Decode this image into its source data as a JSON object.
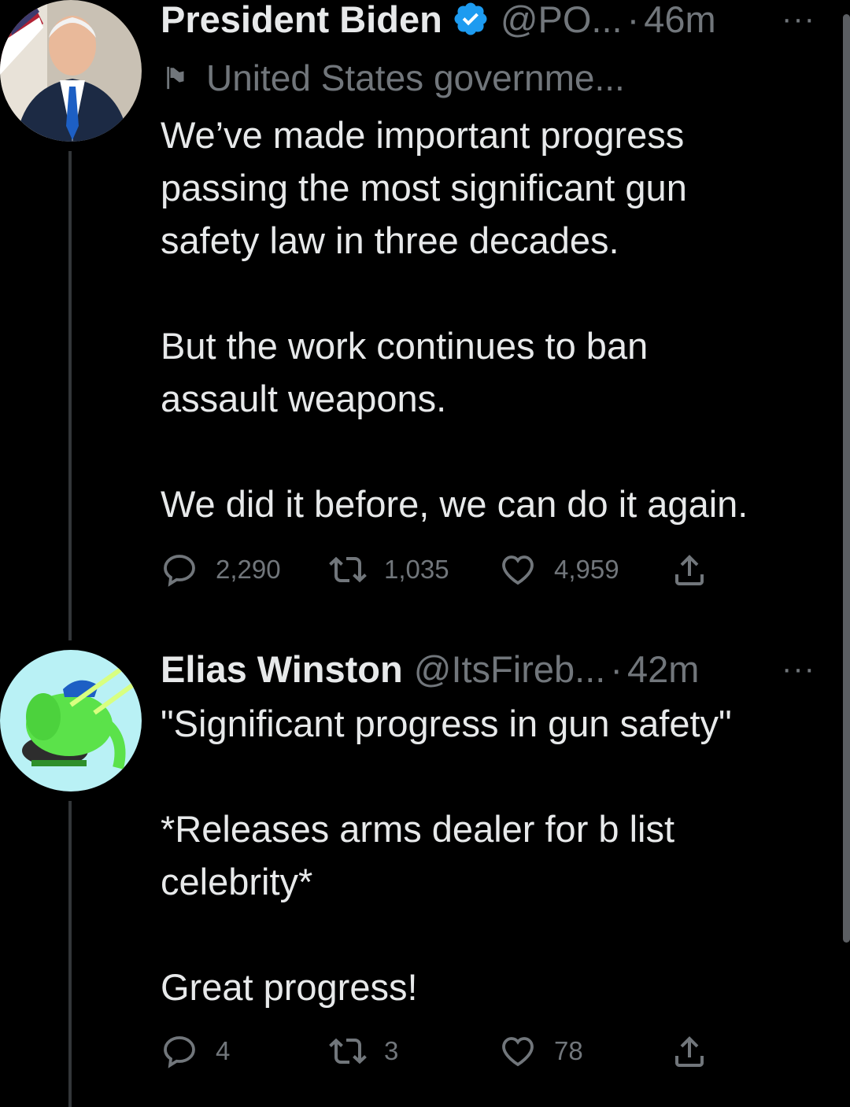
{
  "tweets": [
    {
      "name": "President Biden",
      "handle": "@PO...",
      "dot": "·",
      "time": "46m",
      "more": "···",
      "verified": true,
      "label_icon": "flag-icon",
      "label": "United States governme...",
      "paragraphs": [
        [
          "We’ve made important progress",
          "passing the most significant gun",
          "safety law in three decades."
        ],
        [
          "But the work continues to ban",
          "assault weapons."
        ],
        [
          "We did it before, we can do it again."
        ]
      ],
      "replies": "2,290",
      "retweets": "1,035",
      "likes": "4,959"
    },
    {
      "name": "Elias Winston",
      "handle": "@ItsFireb...",
      "dot": "·",
      "time": "42m",
      "more": "···",
      "paragraphs": [
        [
          "\"Significant progress in gun safety\""
        ],
        [
          "*Releases arms dealer for b list",
          "celebrity*"
        ],
        [
          "Great progress!"
        ]
      ],
      "replies": "4",
      "retweets": "3",
      "likes": "78"
    }
  ],
  "colors": {
    "background": "#000000",
    "text": "#e7e9ea",
    "muted": "#71767b",
    "verified": "#1d9bf0"
  }
}
